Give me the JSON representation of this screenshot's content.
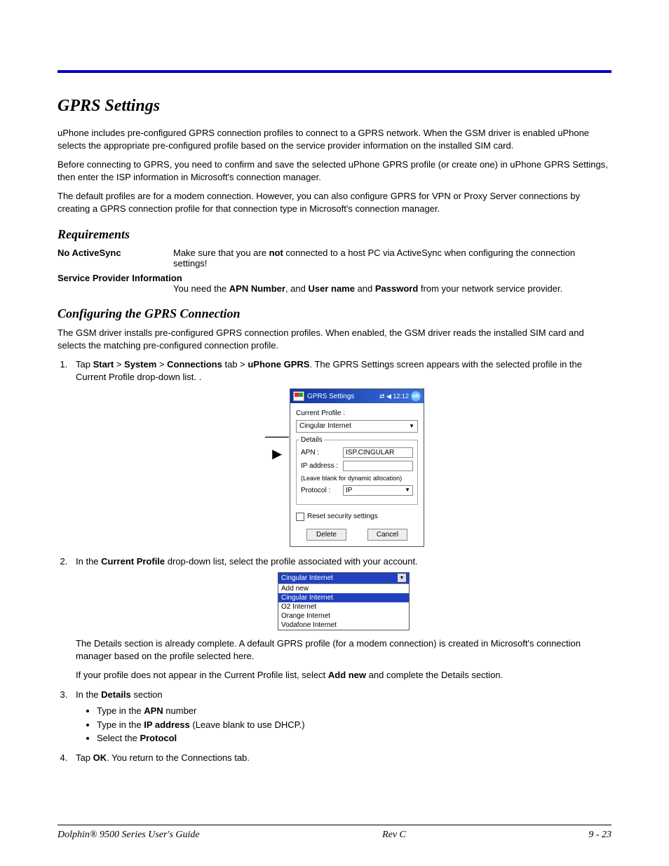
{
  "heading": "GPRS Settings",
  "intro_p1": "uPhone includes pre-configured GPRS connection profiles to connect to a GPRS network. When the GSM driver is enabled uPhone selects the appropriate pre-configured profile based on the service provider information on the installed SIM card.",
  "intro_p2": "Before connecting to GPRS, you need to confirm and save the selected uPhone GPRS profile (or create one) in uPhone GPRS Settings, then enter the ISP information in Microsoft's connection manager.",
  "intro_p3": "The default profiles are for a modem connection. However, you can also configure GPRS for VPN or Proxy Server connections by creating a GPRS connection profile for that connection type in Microsoft's connection manager.",
  "req_heading": "Requirements",
  "req1_label": "No ActiveSync",
  "req1_body_a": "Make sure that you are ",
  "req1_body_b": "not",
  "req1_body_c": " connected to a host PC via ActiveSync when configuring the connection settings!",
  "req2_label": "Service Provider Information",
  "req2_body_a": "You need the ",
  "req2_body_b": "APN Number",
  "req2_body_c": ", and ",
  "req2_body_d": "User name",
  "req2_body_e": " and ",
  "req2_body_f": "Password",
  "req2_body_g": " from your network service provider.",
  "cfg_heading": "Configuring the GPRS Connection",
  "cfg_intro": "The GSM driver installs pre-configured GPRS connection profiles. When enabled, the GSM driver reads the installed SIM card and selects the matching pre-configured connection profile.",
  "step1_a": "Tap ",
  "step1_b": "Start",
  "step1_c": " > ",
  "step1_d": "System",
  "step1_e": " > ",
  "step1_f": "Connections",
  "step1_g": " tab > ",
  "step1_h": "uPhone GPRS",
  "step1_i": ". The GPRS Settings screen appears with the selected profile in the Current Profile drop-down list. .",
  "pda": {
    "title": "GPRS Settings",
    "time": "12:12",
    "ok": "ok",
    "current_profile_label": "Current Profile :",
    "current_profile_value": "Cingular Internet",
    "details_legend": "Details",
    "apn_label": "APN :",
    "apn_value": "ISP.CINGULAR",
    "ip_label": "IP address :",
    "ip_value": "",
    "ip_hint": "(Leave blank for dynamic allocation)",
    "protocol_label": "Protocol :",
    "protocol_value": "IP",
    "reset_label": "Reset security settings",
    "delete": "Delete",
    "cancel": "Cancel"
  },
  "step2_a": "In the ",
  "step2_b": "Current Profile",
  "step2_c": " drop-down list, select the profile associated with your account.",
  "dropdown": {
    "selected": "Cingular Internet",
    "options": [
      "Add new",
      "Cingular Internet",
      "O2 Internet",
      "Orange Internet",
      "Vodafone Internet"
    ],
    "highlighted_index": 1
  },
  "step2_p1": "The Details section is already complete. A default GPRS profile (for a modem connection) is created in Microsoft's connection manager based on the profile selected here.",
  "step2_p2_a": "If your profile does not appear in the Current Profile list, select ",
  "step2_p2_b": "Add new",
  "step2_p2_c": " and complete the Details section.",
  "step3_a": "In the ",
  "step3_b": "Details",
  "step3_c": " section",
  "bullet1_a": "Type in the ",
  "bullet1_b": "APN",
  "bullet1_c": " number",
  "bullet2_a": "Type in the ",
  "bullet2_b": "IP address",
  "bullet2_c": " (Leave blank to use DHCP.)",
  "bullet3_a": "Select the ",
  "bullet3_b": "Protocol",
  "step4_a": "Tap ",
  "step4_b": "OK",
  "step4_c": ". You return to the Connections tab.",
  "footer_left": "Dolphin® 9500 Series User's Guide",
  "footer_center": "Rev C",
  "footer_right": "9 - 23"
}
